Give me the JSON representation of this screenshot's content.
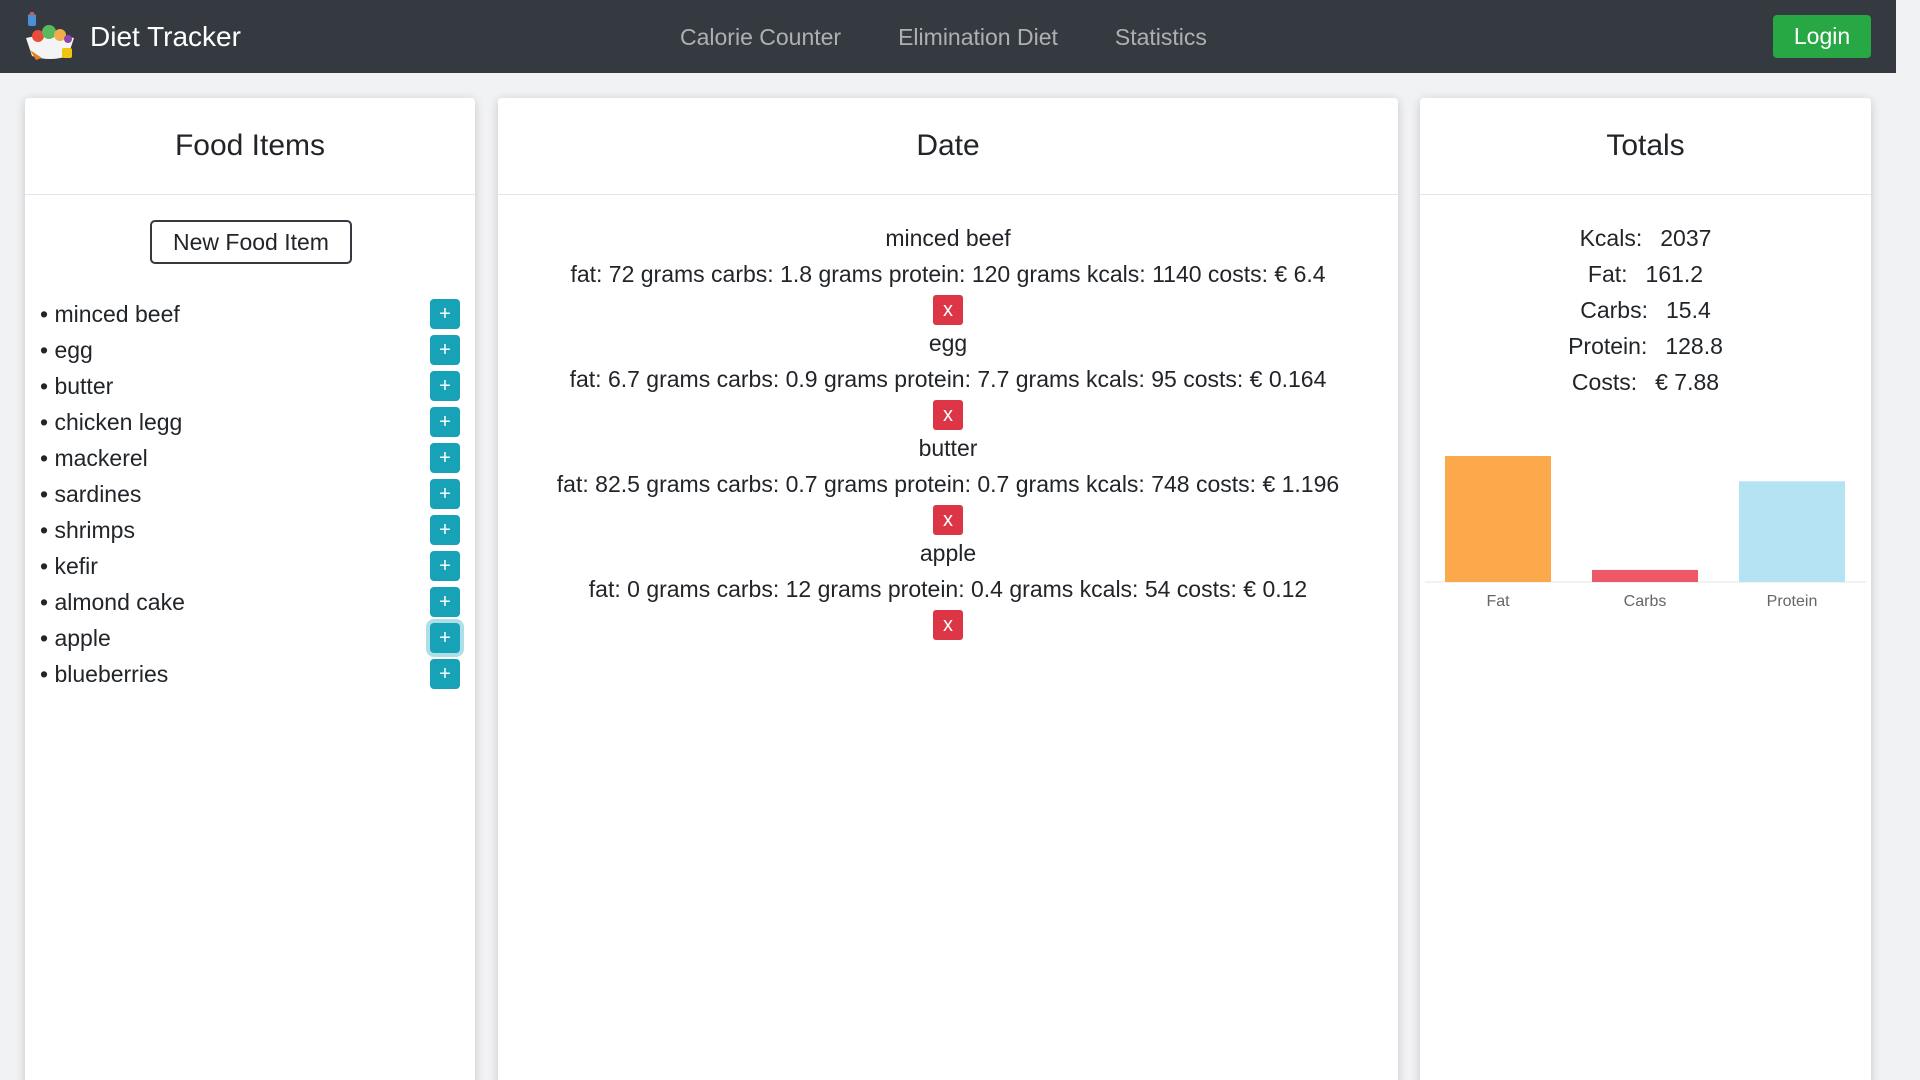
{
  "nav": {
    "brand": "Diet Tracker",
    "links": [
      "Calorie Counter",
      "Elimination Diet",
      "Statistics"
    ],
    "login": "Login"
  },
  "food_panel": {
    "title": "Food Items",
    "new_button": "New Food Item",
    "items": [
      "minced beef",
      "egg",
      "butter",
      "chicken legg",
      "mackerel",
      "sardines",
      "shrimps",
      "kefir",
      "almond cake",
      "apple",
      "blueberries"
    ],
    "add_symbol": "+"
  },
  "date_panel": {
    "title": "Date",
    "remove_symbol": "x",
    "entries": [
      {
        "name": "minced beef",
        "detail": "fat: 72 grams carbs: 1.8 grams protein: 120 grams kcals: 1140 costs: € 6.4"
      },
      {
        "name": "egg",
        "detail": "fat: 6.7 grams carbs: 0.9 grams protein: 7.7 grams kcals: 95 costs: € 0.164"
      },
      {
        "name": "butter",
        "detail": "fat: 82.5 grams carbs: 0.7 grams protein: 0.7 grams kcals: 748 costs: € 1.196"
      },
      {
        "name": "apple",
        "detail": "fat: 0 grams carbs: 12 grams protein: 0.4 grams kcals: 54 costs: € 0.12"
      }
    ]
  },
  "totals_panel": {
    "title": "Totals",
    "rows": [
      {
        "label": "Kcals:",
        "value": "2037"
      },
      {
        "label": "Fat:",
        "value": "161.2"
      },
      {
        "label": "Carbs:",
        "value": "15.4"
      },
      {
        "label": "Protein:",
        "value": "128.8"
      },
      {
        "label": "Costs:",
        "value": "€ 7.88"
      }
    ]
  },
  "chart_data": {
    "type": "bar",
    "categories": [
      "Fat",
      "Carbs",
      "Protein"
    ],
    "values": [
      161.2,
      15.4,
      128.8
    ],
    "colors": [
      "#fba94b",
      "#ee5868",
      "#b5e3f4"
    ],
    "grid": false
  }
}
